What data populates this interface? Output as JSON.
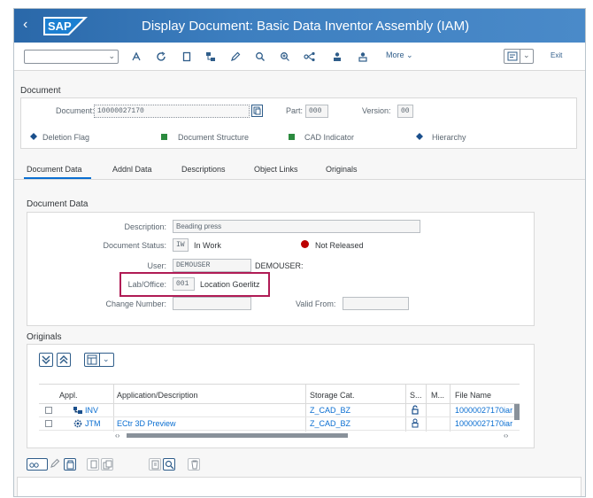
{
  "title": "Display Document: Basic Data Inventor Assembly (IAM)",
  "logo_text": "SAP",
  "toolbar": {
    "more_label": "More",
    "exit_label": "Exit"
  },
  "document_header": {
    "section_label": "Document",
    "document_label": "Document:",
    "document_value": "10000027170",
    "part_label": "Part:",
    "part_value": "000",
    "version_label": "Version:",
    "version_value": "00",
    "legend": [
      {
        "label": "Deletion Flag",
        "color": "#1a4f8c",
        "shape": "diamond"
      },
      {
        "label": "Document Structure",
        "color": "#2b8a3e",
        "shape": "square"
      },
      {
        "label": "CAD Indicator",
        "color": "#2b8a3e",
        "shape": "square"
      },
      {
        "label": "Hierarchy",
        "color": "#1a4f8c",
        "shape": "diamond"
      }
    ]
  },
  "tabs": [
    {
      "label": "Document Data",
      "active": true
    },
    {
      "label": "Addnl Data",
      "active": false
    },
    {
      "label": "Descriptions",
      "active": false
    },
    {
      "label": "Object Links",
      "active": false
    },
    {
      "label": "Originals",
      "active": false
    }
  ],
  "document_data": {
    "section_label": "Document Data",
    "description_label": "Description:",
    "description_value": "Beading press",
    "status_label": "Document Status:",
    "status_code": "IW",
    "status_text": "In Work",
    "release_text": "Not Released",
    "release_color": "#bb0000",
    "user_label": "User:",
    "user_value": "DEMOUSER",
    "user_name": "DEMOUSER:",
    "lab_label": "Lab/Office:",
    "lab_code": "001",
    "lab_text": "Location Goerlitz",
    "change_label": "Change Number:",
    "valid_label": "Valid From:",
    "highlight_color": "#b01b55"
  },
  "originals": {
    "section_label": "Originals",
    "columns": [
      "Appl.",
      "Application/Description",
      "Storage Cat.",
      "S...",
      "M...",
      "File Name"
    ],
    "rows": [
      {
        "appl": "INV",
        "description": "",
        "storage": "Z_CAD_BZ",
        "file": "10000027170iar"
      },
      {
        "appl": "JTM",
        "description": "ECtr 3D Preview",
        "storage": "Z_CAD_BZ",
        "file": "10000027170iar"
      }
    ]
  },
  "colors": {
    "accent": "#0a6ed1",
    "header": "#2a68a9"
  }
}
